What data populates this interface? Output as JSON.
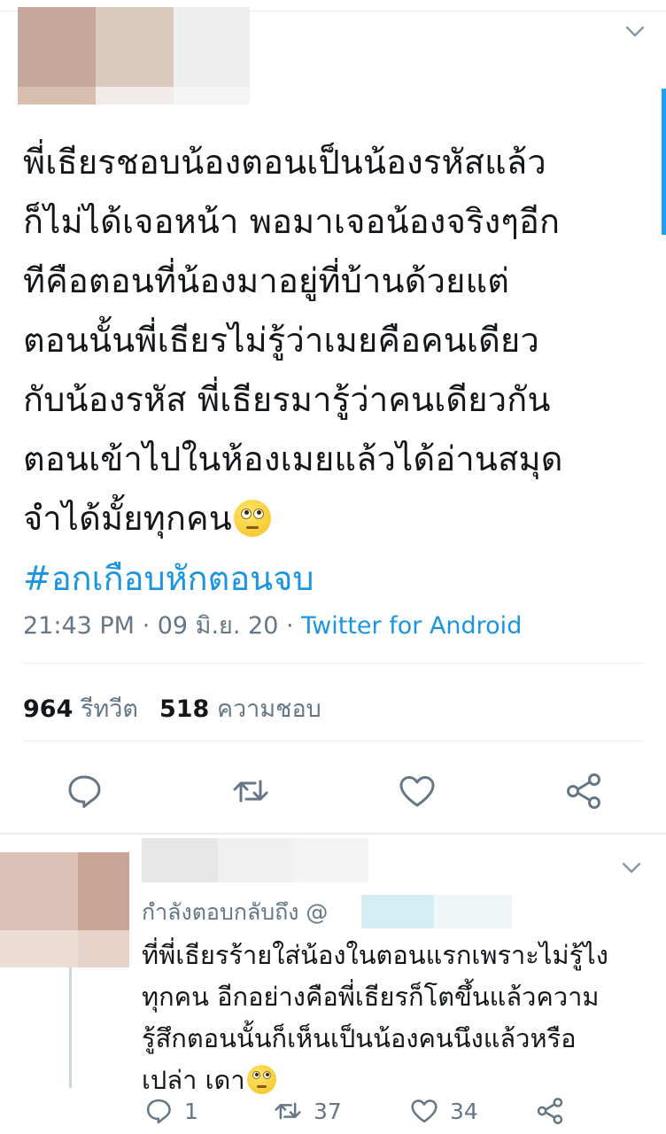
{
  "tweet": {
    "text": "พี่เธียรชอบน้องตอนเป็นน้องรหัสแล้ว\nก็ไม่ได้เจอหน้า พอมาเจอน้องจริงๆอีก\nทีคือตอนที่น้องมาอยู่ที่บ้านด้วยแต่\nตอนนั้นพี่เธียรไม่รู้ว่าเมยคือคนเดียว\nกับน้องรหัส พี่เธียรมารู้ว่าคนเดียวกัน\nตอนเข้าไปในห้องเมยแล้วได้อ่านสมุด\nจำได้มั้ยทุกคน",
    "emoji": "face-with-rolling-eyes-emoji",
    "hashtag": "#อกเกือบหักตอนจบ",
    "time": "21:43 PM",
    "dot1": " · ",
    "date": "09 มิ.ย. 20",
    "dot2": " · ",
    "source": "Twitter for Android",
    "retweets_count": "964",
    "retweets_label": "รีทวีต",
    "likes_count": "518",
    "likes_label": "ความชอบ",
    "actions": [
      "reply-icon",
      "retweet-icon",
      "like-icon",
      "share-icon"
    ]
  },
  "reply": {
    "replying_to": "กำลังตอบกลับถึง @",
    "text": "ที่พี่เธียรร้ายใส่น้องในตอนแรกเพราะไม่รู้ไง\nทุกคน อีกอย่างคือพี่เธียรก็โตขึ้นแล้วความ\nรู้สึกตอนนั้นก็เห็นเป็นน้องคนนึงแล้วหรือ\nเปล่า เดา",
    "reply_count": "1",
    "retweet_count": "37",
    "like_count": "34"
  },
  "colors": {
    "accent": "#1da1f2",
    "link": "#1b95e0",
    "muted": "#657786",
    "divider": "#e6ecf0"
  }
}
